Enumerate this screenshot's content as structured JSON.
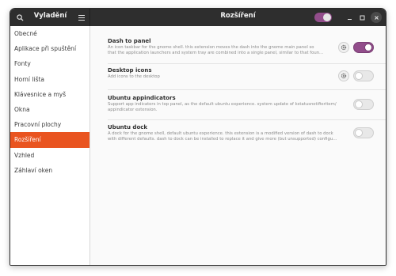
{
  "header": {
    "sidebar_title": "Vyladění",
    "main_title": "Rozšíření",
    "global_switch_on": true,
    "window_buttons": [
      "minimize",
      "maximize",
      "close"
    ]
  },
  "sidebar": {
    "items": [
      {
        "label": "Obecné",
        "active": false
      },
      {
        "label": "Aplikace při spuštění",
        "active": false
      },
      {
        "label": "Fonty",
        "active": false
      },
      {
        "label": "Horní lišta",
        "active": false
      },
      {
        "label": "Klávesnice a myš",
        "active": false
      },
      {
        "label": "Okna",
        "active": false
      },
      {
        "label": "Pracovní plochy",
        "active": false
      },
      {
        "label": "Rozšíření",
        "active": true
      },
      {
        "label": "Vzhled",
        "active": false
      },
      {
        "label": "Záhlaví oken",
        "active": false
      }
    ]
  },
  "extensions": [
    {
      "name": "Dash to panel",
      "description": "An icon taskbar for the gnome shell. this extension moves the dash into the gnome main panel so\nthat the application launchers and system tray are combined into a single panel, similar to that foun…",
      "has_settings": true,
      "enabled": true
    },
    {
      "name": "Desktop icons",
      "description": "Add icons to the desktop",
      "has_settings": true,
      "enabled": false
    },
    {
      "name": "Ubuntu appindicators",
      "description": "Support app indicators in top panel, as the default ubuntu experience. system update of kstatusnotifieritem/\nappindicator extension.",
      "has_settings": false,
      "enabled": false
    },
    {
      "name": "Ubuntu dock",
      "description": "A dock for the gnome shell, default ubuntu experience. this extension is a modified version of dash to dock\nwith different defaults. dash to dock can be installed to replace it and give more (but unsupported) configu…",
      "has_settings": false,
      "enabled": false
    }
  ],
  "colors": {
    "accent_orange": "#e95420",
    "toggle_purple": "#924d8b",
    "header_bg": "#2e2e2e"
  }
}
